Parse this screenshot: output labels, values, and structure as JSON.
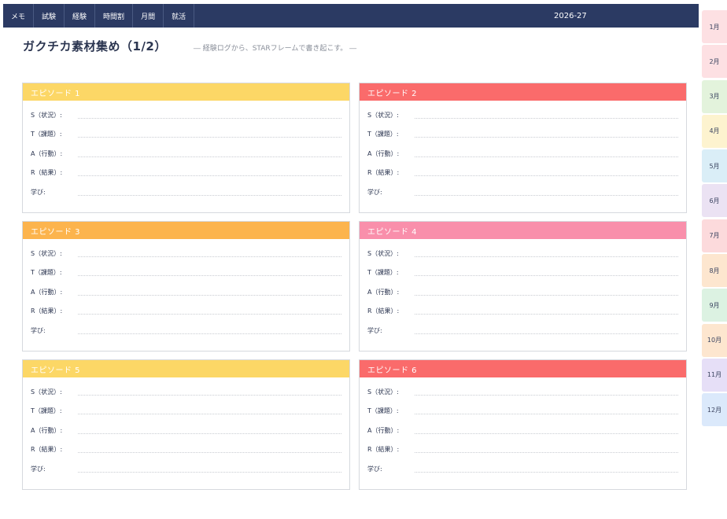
{
  "nav": {
    "tabs": [
      {
        "label": "メモ"
      },
      {
        "label": "試験"
      },
      {
        "label": "経験"
      },
      {
        "label": "時間割"
      },
      {
        "label": "月間"
      },
      {
        "label": "就活"
      }
    ],
    "year": "2026-27"
  },
  "header": {
    "title": "ガクチカ素材集め（1/2）",
    "subtitle": "― 経験ログから、STARフレームで書き起こす。 ―"
  },
  "fields": {
    "s": "S（状況）:",
    "t": "T（課題）:",
    "a": "A（行動）:",
    "r": "R（結果）:",
    "learn": "学び:"
  },
  "episodes": [
    {
      "title": "エピソード 1",
      "color": "#fcd766"
    },
    {
      "title": "エピソード 2",
      "color": "#fa6b6b"
    },
    {
      "title": "エピソード 3",
      "color": "#fcb44d"
    },
    {
      "title": "エピソード 4",
      "color": "#f98fab"
    },
    {
      "title": "エピソード 5",
      "color": "#fcd766"
    },
    {
      "title": "エピソード 6",
      "color": "#fa6b6b"
    }
  ],
  "months": [
    {
      "label": "1月",
      "color": "#fde0e3"
    },
    {
      "label": "2月",
      "color": "#fde0e3"
    },
    {
      "label": "3月",
      "color": "#e3f3dc"
    },
    {
      "label": "4月",
      "color": "#fdf3cf"
    },
    {
      "label": "5月",
      "color": "#daeef7"
    },
    {
      "label": "6月",
      "color": "#ebe2f3"
    },
    {
      "label": "7月",
      "color": "#fcdadc"
    },
    {
      "label": "8月",
      "color": "#fde6cf"
    },
    {
      "label": "9月",
      "color": "#dcf2e2"
    },
    {
      "label": "10月",
      "color": "#fde6cf"
    },
    {
      "label": "11月",
      "color": "#e6dff7"
    },
    {
      "label": "12月",
      "color": "#dbe9fb"
    }
  ]
}
